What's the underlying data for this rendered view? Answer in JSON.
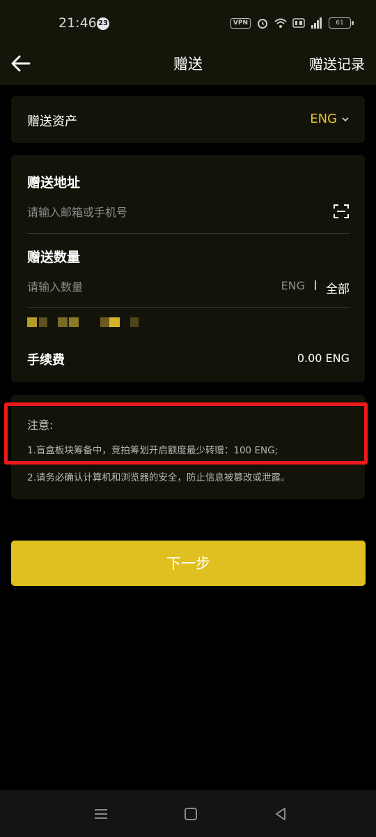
{
  "status_bar": {
    "time": "21:46",
    "notification_count": "23",
    "vpn_label": "VPN",
    "battery_level": "61"
  },
  "header": {
    "title": "赠送",
    "record_label": "赠送记录"
  },
  "asset": {
    "label": "赠送资产",
    "value": "ENG"
  },
  "address": {
    "title": "赠送地址",
    "placeholder": "请输入邮箱或手机号"
  },
  "amount": {
    "title": "赠送数量",
    "placeholder": "请输入数量",
    "unit": "ENG",
    "all_label": "全部"
  },
  "fee": {
    "label": "手续费",
    "value": "0.00 ENG"
  },
  "notice": {
    "title": "注意:",
    "lines": [
      "1.盲盒板块筹备中，竞拍筹划开启额度最少转赠：100 ENG;",
      "2.请务必确认计算机和浏览器的安全，防止信息被篡改或泄露。"
    ]
  },
  "next_button": {
    "label": "下一步"
  },
  "colors": {
    "accent": "#e0c020",
    "asset_highlight": "#e6c22a",
    "card_bg": "#141309",
    "annotation_red": "#ee1a1a"
  }
}
